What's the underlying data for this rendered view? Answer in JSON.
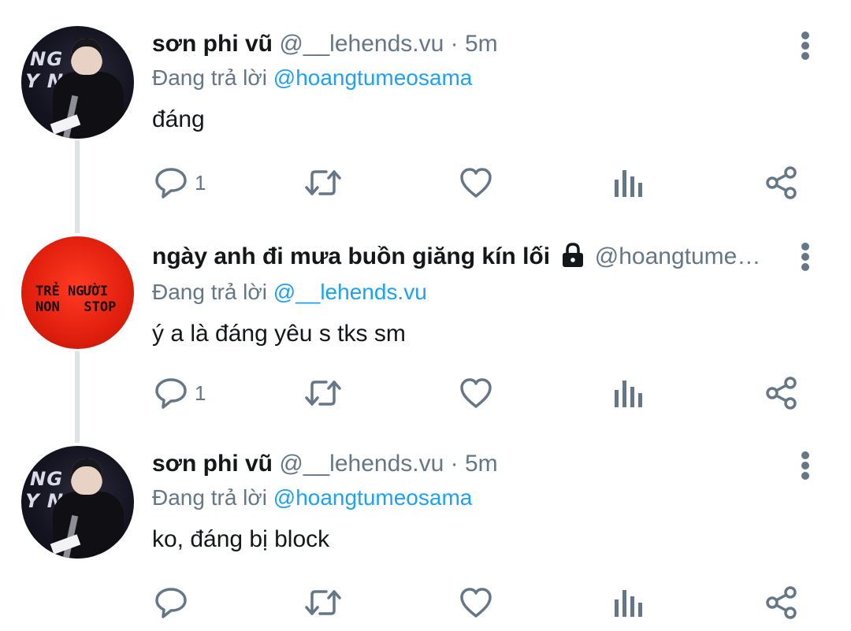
{
  "tweets": [
    {
      "name": "sơn phi vũ",
      "handle": "@__lehends.vu",
      "dot": "·",
      "time": "5m",
      "replying_prefix": "Đang trả lời",
      "replying_to": "@hoangtumeosama",
      "text": "đáng",
      "reply_count": "1",
      "avatar_icon": "avatar-stage-photo"
    },
    {
      "name": "ngày anh đi mưa buồn giăng kín lối",
      "handle": "@hoangtume…",
      "replying_prefix": "Đang trả lời",
      "replying_to": "@__lehends.vu",
      "text": "ý a là đáng yêu s tks sm",
      "reply_count": "1",
      "avatar_text": "TRẺ NGƯỜI\nNON   STOP",
      "avatar_icon": "avatar-red-shirt",
      "protected_icon": "lock-icon"
    },
    {
      "name": "sơn phi vũ",
      "handle": "@__lehends.vu",
      "dot": "·",
      "time": "5m",
      "replying_prefix": "Đang trả lời",
      "replying_to": "@hoangtumeosama",
      "text": "ko, đáng bị block",
      "reply_count": "",
      "avatar_icon": "avatar-stage-photo"
    }
  ],
  "avatar_a_text": "NG\nY No",
  "colors": {
    "secondary_text": "#657786",
    "link": "#1da1f2",
    "primary_text": "#14171a",
    "thread_line": "#dfe3e7"
  },
  "action_icons": [
    "reply-icon",
    "retweet-icon",
    "like-icon",
    "analytics-icon",
    "share-icon"
  ]
}
